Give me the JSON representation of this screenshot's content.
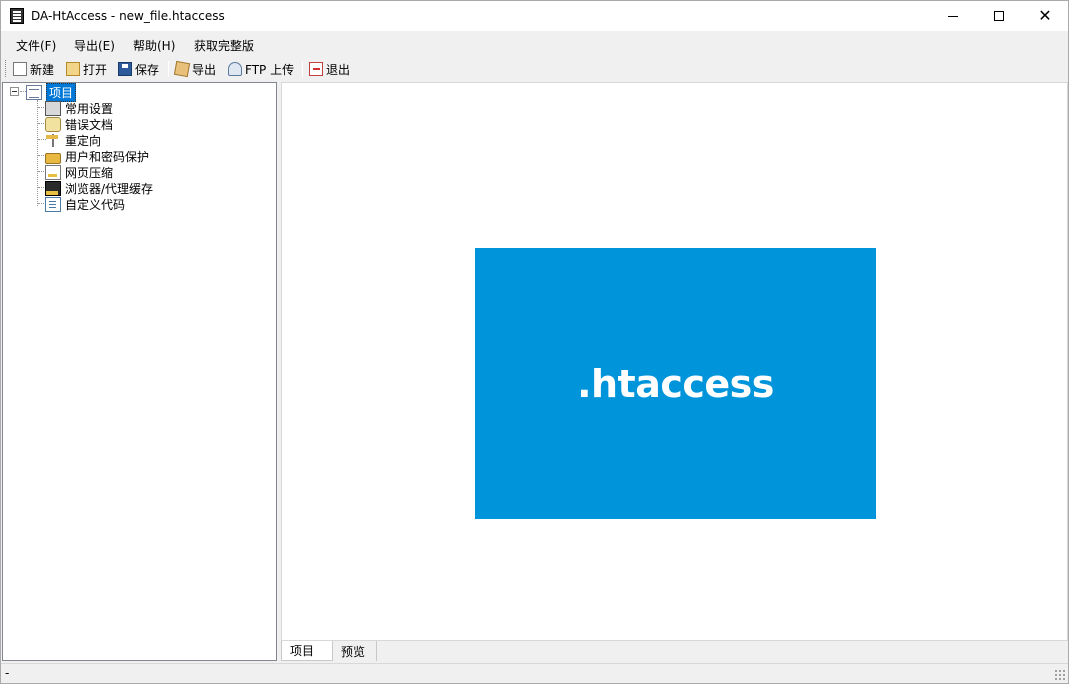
{
  "window": {
    "title": "DA-HtAccess - new_file.htaccess"
  },
  "menu": {
    "items": [
      "文件(F)",
      "导出(E)",
      "帮助(H)",
      "获取完整版"
    ]
  },
  "toolbar": {
    "new_label": "新建",
    "open_label": "打开",
    "save_label": "保存",
    "export_label": "导出",
    "ftp_label": "FTP 上传",
    "exit_label": "退出"
  },
  "tree": {
    "root": "项目",
    "items": [
      "常用设置",
      "错误文档",
      "重定向",
      "用户和密码保护",
      "网页压缩",
      "浏览器/代理缓存",
      "自定义代码"
    ]
  },
  "content": {
    "banner_text": ".htaccess",
    "banner_color": "#0094da"
  },
  "tabs": [
    "项目",
    "预览"
  ],
  "status": {
    "text": "-"
  }
}
